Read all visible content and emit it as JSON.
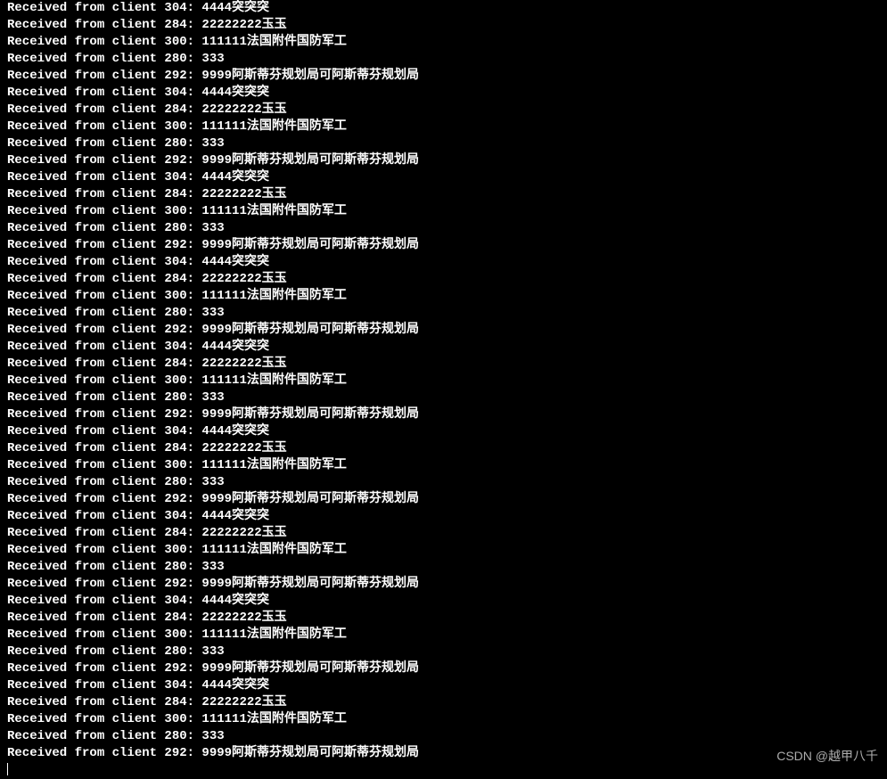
{
  "terminal": {
    "lines": [
      "Received from client 304: 4444突突突",
      "Received from client 284: 22222222玉玉",
      "Received from client 300: 111111法国附件国防军工",
      "Received from client 280: 333",
      "Received from client 292: 9999阿斯蒂芬规划局可阿斯蒂芬规划局",
      "Received from client 304: 4444突突突",
      "Received from client 284: 22222222玉玉",
      "Received from client 300: 111111法国附件国防军工",
      "Received from client 280: 333",
      "Received from client 292: 9999阿斯蒂芬规划局可阿斯蒂芬规划局",
      "Received from client 304: 4444突突突",
      "Received from client 284: 22222222玉玉",
      "Received from client 300: 111111法国附件国防军工",
      "Received from client 280: 333",
      "Received from client 292: 9999阿斯蒂芬规划局可阿斯蒂芬规划局",
      "Received from client 304: 4444突突突",
      "Received from client 284: 22222222玉玉",
      "Received from client 300: 111111法国附件国防军工",
      "Received from client 280: 333",
      "Received from client 292: 9999阿斯蒂芬规划局可阿斯蒂芬规划局",
      "Received from client 304: 4444突突突",
      "Received from client 284: 22222222玉玉",
      "Received from client 300: 111111法国附件国防军工",
      "Received from client 280: 333",
      "Received from client 292: 9999阿斯蒂芬规划局可阿斯蒂芬规划局",
      "Received from client 304: 4444突突突",
      "Received from client 284: 22222222玉玉",
      "Received from client 300: 111111法国附件国防军工",
      "Received from client 280: 333",
      "Received from client 292: 9999阿斯蒂芬规划局可阿斯蒂芬规划局",
      "Received from client 304: 4444突突突",
      "Received from client 284: 22222222玉玉",
      "Received from client 300: 111111法国附件国防军工",
      "Received from client 280: 333",
      "Received from client 292: 9999阿斯蒂芬规划局可阿斯蒂芬规划局",
      "Received from client 304: 4444突突突",
      "Received from client 284: 22222222玉玉",
      "Received from client 300: 111111法国附件国防军工",
      "Received from client 280: 333",
      "Received from client 292: 9999阿斯蒂芬规划局可阿斯蒂芬规划局",
      "Received from client 304: 4444突突突",
      "Received from client 284: 22222222玉玉",
      "Received from client 300: 111111法国附件国防军工",
      "Received from client 280: 333",
      "Received from client 292: 9999阿斯蒂芬规划局可阿斯蒂芬规划局"
    ]
  },
  "watermark": {
    "text": "CSDN @越甲八千"
  }
}
